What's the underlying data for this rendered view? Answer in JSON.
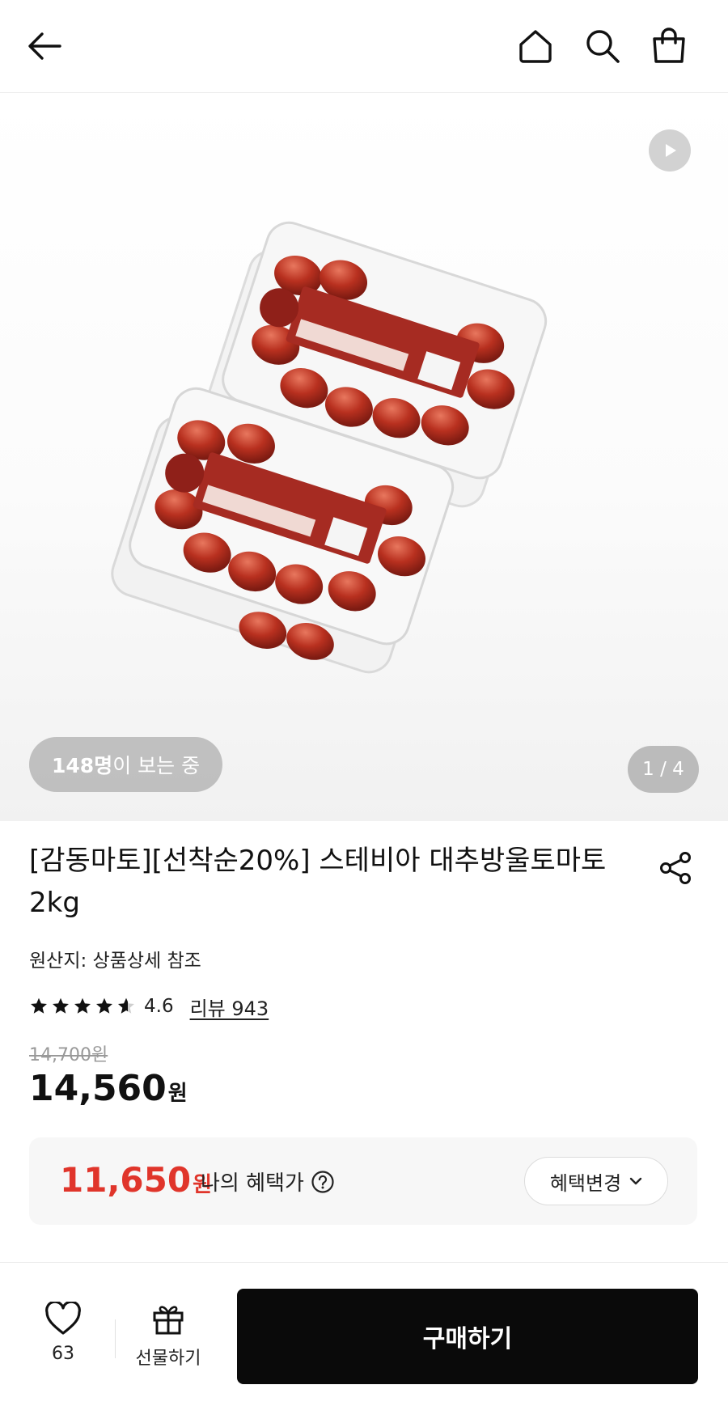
{
  "header": {
    "back_icon": "back-arrow-icon",
    "home_icon": "home-icon",
    "search_icon": "search-icon",
    "cart_icon": "shopping-bag-icon"
  },
  "gallery": {
    "viewers_count": "148명",
    "viewers_suffix": "이 보는 중",
    "page_indicator": "1 / 4",
    "play_icon": "play-icon",
    "image_description": "tomato-package-image"
  },
  "product": {
    "title": "[감동마토][선착순20%] 스테비아 대추방울토마토 2kg",
    "origin": "원산지: 상품상세 참조",
    "rating": "4.6",
    "rating_stars": 4.6,
    "review_link": "리뷰 943",
    "original_price": "14,700원",
    "price": "14,560",
    "price_unit": "원"
  },
  "benefit": {
    "price": "11,650",
    "price_unit": "원",
    "label": "나의 혜택가",
    "change_button": "혜택변경"
  },
  "bottom_bar": {
    "like_count": "63",
    "gift_label": "선물하기",
    "buy_label": "구매하기"
  },
  "colors": {
    "accent_red": "#e0352b",
    "buy_button": "#0a0a0a"
  }
}
